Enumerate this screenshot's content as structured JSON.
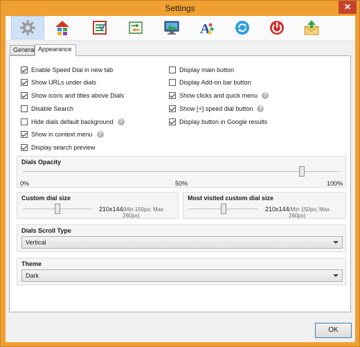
{
  "window": {
    "title": "Settings"
  },
  "toolbar": {
    "tools": [
      {
        "icon": "gear-icon"
      },
      {
        "icon": "home-grid-icon"
      },
      {
        "icon": "checklist-icon"
      },
      {
        "icon": "import-export-icon"
      },
      {
        "icon": "monitor-icon"
      },
      {
        "icon": "font-color-icon"
      },
      {
        "icon": "sync-icon"
      },
      {
        "icon": "power-icon"
      },
      {
        "icon": "mail-upload-icon"
      }
    ]
  },
  "tabs": [
    {
      "label": "General",
      "active": false
    },
    {
      "label": "Appearance",
      "active": true
    }
  ],
  "left_options": [
    {
      "label": "Enable Speed Dial in new tab",
      "checked": true
    },
    {
      "label": "Show URLs under dials",
      "checked": true
    },
    {
      "label": "Show icons and titles above Dials",
      "checked": true
    },
    {
      "label": "Disable Search",
      "checked": false
    },
    {
      "label": "Hide dials default background",
      "checked": false
    },
    {
      "label": "Show in context menu",
      "checked": true
    },
    {
      "label": "Display search preview",
      "checked": true
    }
  ],
  "right_options": [
    {
      "label": "Display main button",
      "checked": false
    },
    {
      "label": "Display Add-on bar button",
      "checked": false
    },
    {
      "label": "Show clicks and quick menu",
      "checked": true
    },
    {
      "label": "Show [+] speed dial button",
      "checked": true
    },
    {
      "label": "Display button in Google results",
      "checked": true
    }
  ],
  "opacity": {
    "title": "Dials Opacity",
    "min_label": "0%",
    "mid_label": "50%",
    "max_label": "100%",
    "value_percent": 88
  },
  "custom_dial": {
    "title": "Custom dial size",
    "value": "210x144",
    "hint": "(Min 150px; Max 260px)",
    "level": 0.5
  },
  "most_visited": {
    "title": "Most visited custom dial size",
    "value": "210x144",
    "hint": "(Min 150px; Max 260px)",
    "level": 0.5
  },
  "scroll_type": {
    "title": "Dials Scroll Type",
    "selected": "Vertical"
  },
  "theme": {
    "title": "Theme",
    "selected": "Dark"
  },
  "buttons": {
    "ok_label": "OK",
    "close_label": "✕"
  }
}
